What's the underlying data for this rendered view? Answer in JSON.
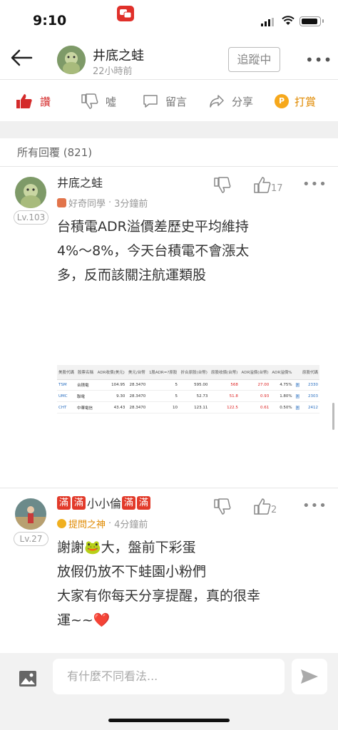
{
  "status_bar": {
    "time": "9:10"
  },
  "header": {
    "author_name": "井底之蛙",
    "post_time": "22小時前",
    "follow_label": "追蹤中",
    "more_icon": "more-icon",
    "back_icon": "back-arrow-icon"
  },
  "actions": {
    "like": "讚",
    "boo": "噓",
    "comment": "留言",
    "share": "分享",
    "tip": "打賞",
    "tip_coin": "P"
  },
  "replies_label": "所有回覆 (821)",
  "comments": [
    {
      "name": "井底之蛙",
      "badges": [],
      "level": "Lv.103",
      "title": "好奇同學",
      "time": "3分鐘前",
      "likes": "17",
      "body": [
        "台積電ADR溢價差歷史平均維持",
        "4%～8%，今天台積電不會漲太",
        "多，反而該關注航運類股"
      ]
    },
    {
      "name_prefix": "滿",
      "name_prefix2": "滿",
      "name": "小小倫",
      "name_suffix": "滿",
      "name_suffix2": "滿",
      "level": "Lv.27",
      "title": "提問之神",
      "time": "4分鐘前",
      "likes": "2",
      "body": [
        "謝謝🐸大，盤前下彩蛋",
        "放假仍放不下蛙園小粉們",
        "大家有你每天分享提醒，真的很幸",
        "運~~❤️"
      ]
    }
  ],
  "adr_table": {
    "headers": [
      "美股代碼",
      "股票名稱",
      "ADR收價(美元)",
      "美元/台幣",
      "1股ADR=?原股",
      "折合原股(台幣)",
      "原股收價(台幣)",
      "ADR溢價(台幣)",
      "ADR溢價%",
      "",
      "原股代碼"
    ],
    "rows": [
      [
        "TSM",
        "台積電",
        "104.95",
        "28.3470",
        "5",
        "595.00",
        "568",
        "27.00",
        "4.75%",
        "圖",
        "2330"
      ],
      [
        "UMC",
        "聯電",
        "9.30",
        "28.3470",
        "5",
        "52.73",
        "51.8",
        "0.93",
        "1.80%",
        "圖",
        "2303"
      ],
      [
        "CHT",
        "中華電信",
        "43.43",
        "28.3470",
        "10",
        "123.11",
        "122.5",
        "0.61",
        "0.50%",
        "圖",
        "2412"
      ]
    ]
  },
  "composer": {
    "placeholder": "有什麼不同看法..."
  },
  "colors": {
    "accent_red": "#d42a2a",
    "tip_orange": "#f6a81b"
  }
}
